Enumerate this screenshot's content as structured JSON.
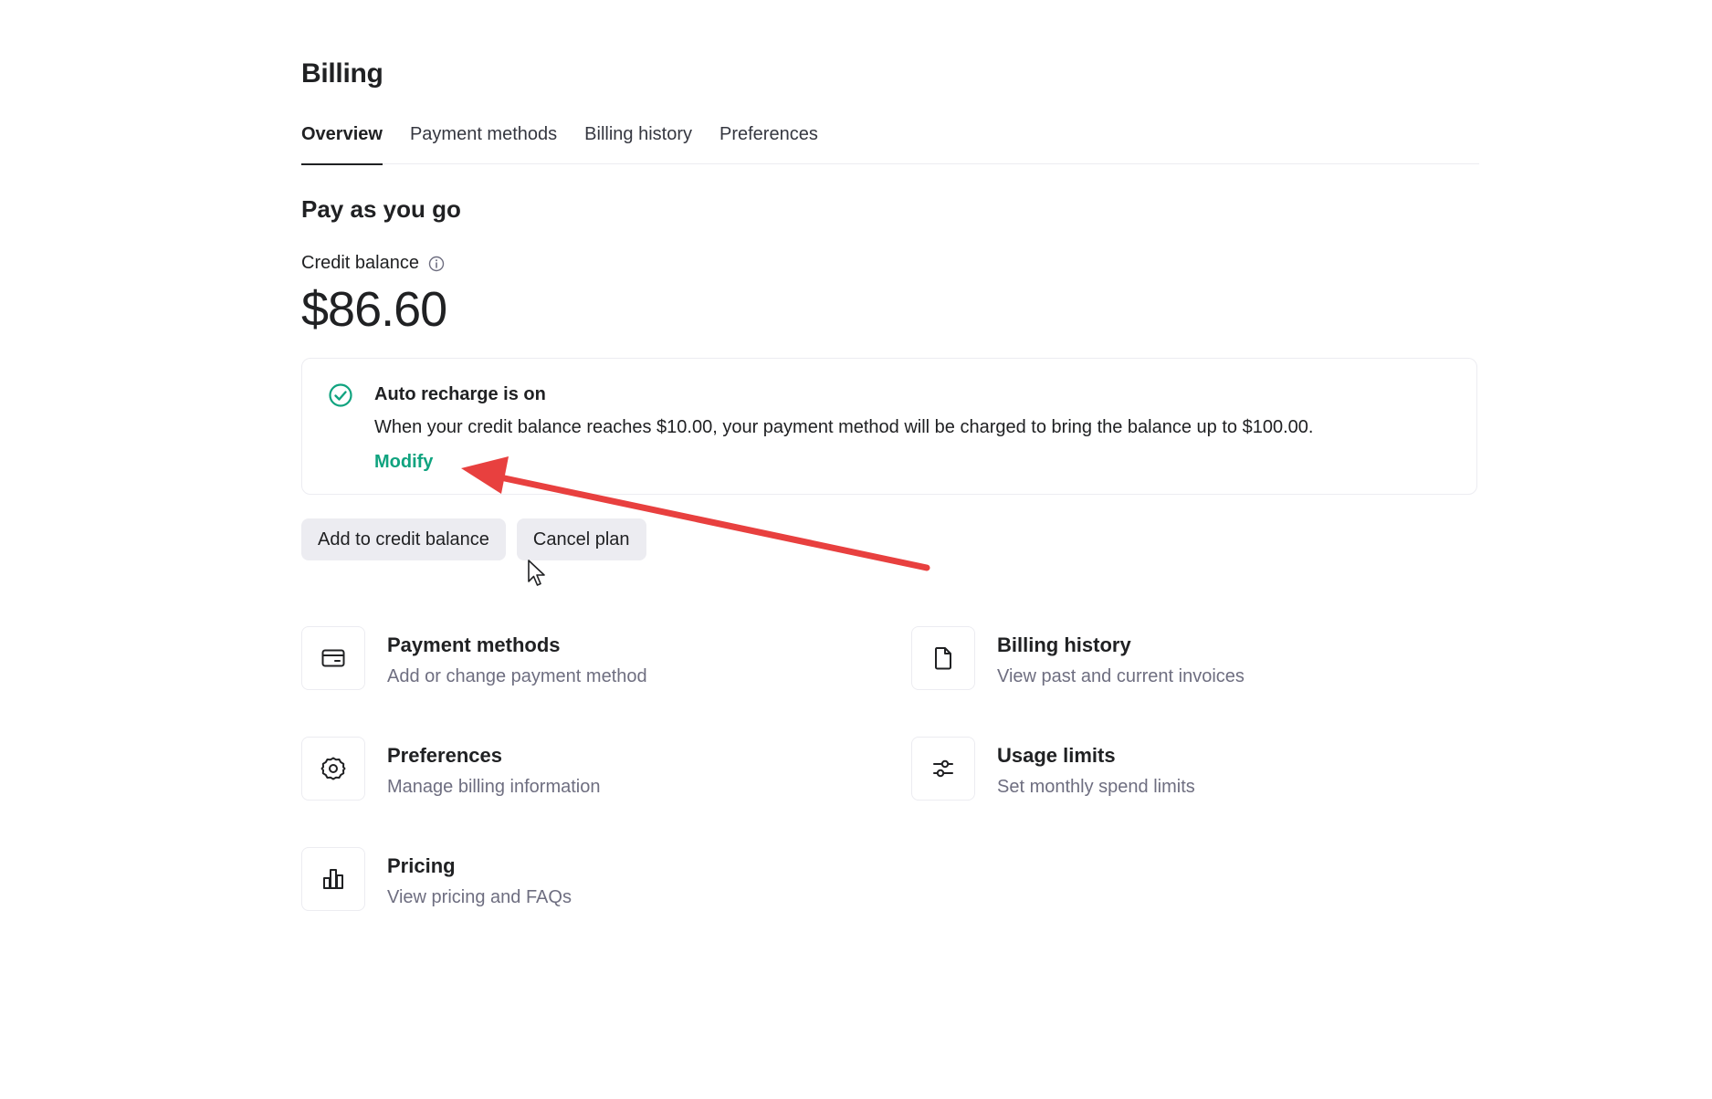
{
  "page": {
    "title": "Billing"
  },
  "tabs": [
    {
      "label": "Overview",
      "active": true
    },
    {
      "label": "Payment methods",
      "active": false
    },
    {
      "label": "Billing history",
      "active": false
    },
    {
      "label": "Preferences",
      "active": false
    }
  ],
  "plan": {
    "title": "Pay as you go",
    "credit_label": "Credit balance",
    "credit_amount": "$86.60"
  },
  "recharge": {
    "title": "Auto recharge is on",
    "description": "When your credit balance reaches $10.00, your payment method will be charged to bring the balance up to $100.00.",
    "modify_label": "Modify"
  },
  "actions": {
    "add_credit": "Add to credit balance",
    "cancel_plan": "Cancel plan"
  },
  "links": [
    {
      "title": "Payment methods",
      "subtitle": "Add or change payment method",
      "icon": "credit-card-icon"
    },
    {
      "title": "Billing history",
      "subtitle": "View past and current invoices",
      "icon": "document-icon"
    },
    {
      "title": "Preferences",
      "subtitle": "Manage billing information",
      "icon": "gear-icon"
    },
    {
      "title": "Usage limits",
      "subtitle": "Set monthly spend limits",
      "icon": "sliders-icon"
    },
    {
      "title": "Pricing",
      "subtitle": "View pricing and FAQs",
      "icon": "bar-chart-icon"
    }
  ],
  "colors": {
    "accent": "#10a37f",
    "annotation": "#e8403f",
    "button_bg": "#ececf1"
  }
}
